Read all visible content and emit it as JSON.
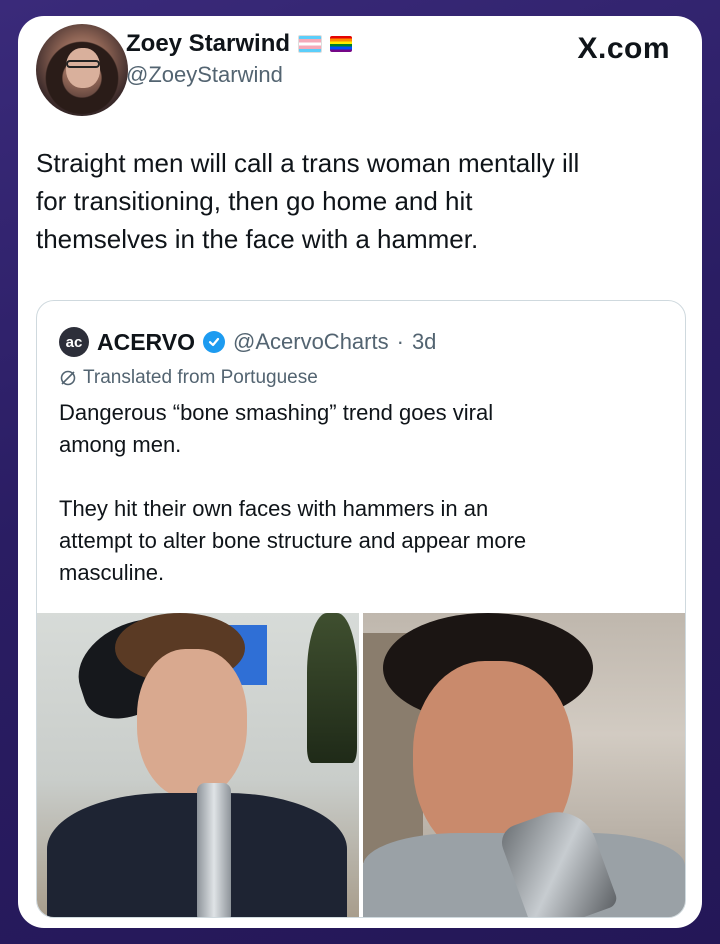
{
  "tweet": {
    "author_name": "Zoey Starwind",
    "author_handle": "@ZoeyStarwind",
    "flags": [
      "transgender-flag-icon",
      "rainbow-flag-icon"
    ],
    "brand": "X.com",
    "text_lines": [
      "Straight men will call a trans woman mentally ill",
      "for transitioning, then go home and hit",
      "themselves in the face with a hammer."
    ]
  },
  "quoted_tweet": {
    "logo_text": "ac",
    "name": "ACERVO",
    "verified": true,
    "handle": "@AcervoCharts",
    "separator": "·",
    "time": "3d",
    "translated_label": "Translated from Portuguese",
    "paragraphs": [
      [
        "Dangerous “bone smashing” trend goes viral",
        "among men."
      ],
      [
        "They hit their own faces with hammers in an",
        "attempt to alter bone structure and appear more",
        "masculine."
      ]
    ],
    "images": [
      "photo-left",
      "photo-right"
    ]
  },
  "colors": {
    "background": "#2a1d63",
    "text_primary": "#0f1419",
    "text_secondary": "#536471",
    "verified_blue": "#1d9bf0"
  }
}
